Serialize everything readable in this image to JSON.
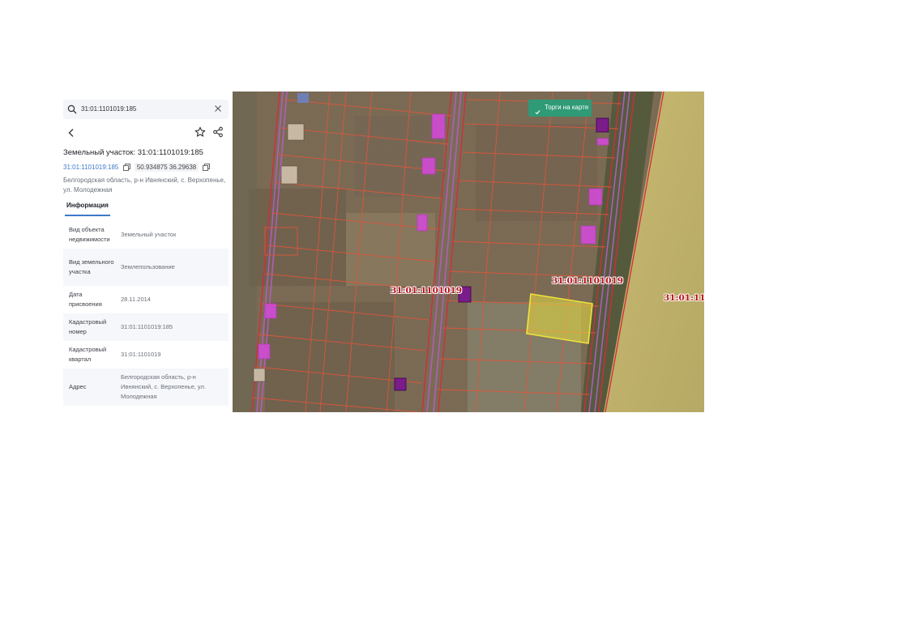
{
  "search": {
    "value": "31:01:1101019:185"
  },
  "parcel": {
    "title": "Земельный участок: 31:01:1101019:185",
    "cad_link": "31:01:1101019:185",
    "coords": "50.934875 36.29638",
    "address_line": "Белгородская область, р-н Ивнянский, с. Верхопенье, ул. Молодежная"
  },
  "tabs": [
    {
      "label": "Информация"
    }
  ],
  "properties": [
    {
      "key": "Вид объекта недвижимости",
      "value": "Земельный участок"
    },
    {
      "key": "Вид земельного участка",
      "value": "Землепользование"
    },
    {
      "key": "Дата присвоения",
      "value": "28.11.2014"
    },
    {
      "key": "Кадастровый номер",
      "value": "31:01:1101019:185"
    },
    {
      "key": "Кадастровый квартал",
      "value": "31:01:1101019"
    },
    {
      "key": "Адрес",
      "value": "Белгородская область, р-н Ивнянский, с. Верхопенье, ул. Молодежная"
    }
  ],
  "map": {
    "torgi_badge": "Торги на карте",
    "quarter_labels": [
      "31:01:1101019",
      "31:01:1101019",
      "31:01:1101"
    ],
    "colors": {
      "parcel_line": "#e0553a",
      "quarter_line": "#d62a3a",
      "building": "#d24bd6",
      "selected_fill": "#e8dc3f",
      "badge": "#2f9a76"
    }
  }
}
